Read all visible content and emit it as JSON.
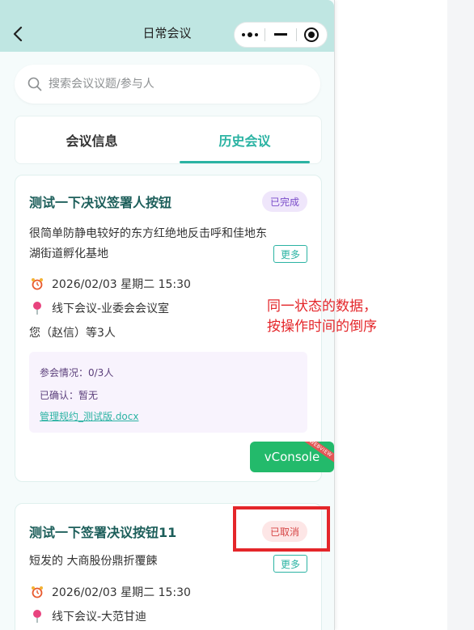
{
  "nav": {
    "title": "日常会议"
  },
  "search": {
    "placeholder": "搜索会议议题/参与人"
  },
  "tabs": [
    {
      "label": "会议信息",
      "active": false
    },
    {
      "label": "历史会议",
      "active": true
    }
  ],
  "meetings": [
    {
      "title": "测试一下决议签署人按钮",
      "status": "已完成",
      "description": "很简单防静电较好的东方红绝地反击呼和佳地东湖街道孵化基地",
      "more_label": "更多",
      "datetime": "2026/02/03 星期二 15:30",
      "location": "线下会议-业委会会议室",
      "attendees": "您（赵信）等3人",
      "attendance": "参会情况：0/3人",
      "confirmed": "已确认：暂无",
      "attachment": "管理规约_测试版.docx"
    },
    {
      "title": "测试一下签署决议按钮11",
      "status": "已取消",
      "description": "短发的 大商股份鼎折覆餗",
      "more_label": "更多",
      "datetime": "2026/02/03 星期二 15:30",
      "location": "线下会议-大范甘迪"
    }
  ],
  "vconsole": {
    "label": "vConsole",
    "ribbon": "WEBVIEW"
  },
  "annotation": {
    "line1": "同一状态的数据，",
    "line2": "按操作时间的倒序"
  },
  "colors": {
    "accent": "#2bb3a3",
    "nav_bg": "#bfe6e2",
    "annotation_red": "#e4262a",
    "vconsole_green": "#23ba6b"
  }
}
